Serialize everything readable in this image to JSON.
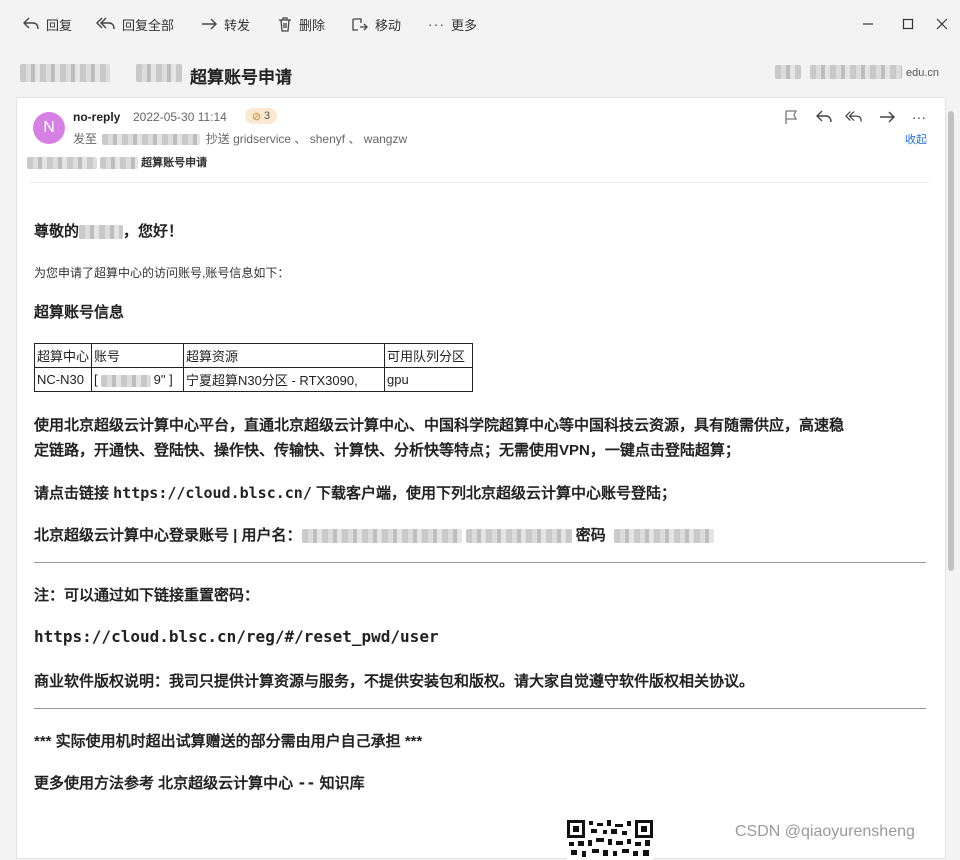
{
  "toolbar": {
    "reply": "回复",
    "reply_all": "回复全部",
    "forward": "转发",
    "delete": "删除",
    "move": "移动",
    "more": "更多"
  },
  "subject": "超算账号申请",
  "sender_domain": "edu.cn",
  "header": {
    "avatar_letter": "N",
    "from": "no-reply",
    "date": "2022-05-30 11:14",
    "attachments": "3",
    "to_prefix": "发至",
    "cc_prefix": "抄送",
    "cc_list": "gridservice 、 shenyf 、 wangzw",
    "collapse": "收起",
    "subject_small": "超算账号申请"
  },
  "body": {
    "greeting_a": "尊敬的",
    "greeting_b": "，您好！",
    "intro": "为您申请了超算中心的访问账号,账号信息如下：",
    "section_title": "超算账号信息",
    "table": {
      "headers": [
        "超算中心",
        "账号",
        "超算资源",
        "可用队列分区"
      ],
      "row": [
        "NC-N30",
        "[",
        "9\" ]",
        "宁夏超算N30分区 - RTX3090,",
        "gpu"
      ]
    },
    "para1_line1": "使用北京超级云计算中心平台，直通北京超级云计算中心、中国科学院超算中心等中国科技云资源，具有随需供应，高速稳",
    "para1_line2": "定链路，开通快、登陆快、操作快、传输快、计算快、分析快等特点；无需使用VPN，一键点击登陆超算；",
    "para2_a": "请点击链接 ",
    "para2_link": "https://cloud.blsc.cn/",
    "para2_b": " 下载客户端，使用下列北京超级云计算中心账号登陆；",
    "login_label": "北京超级云计算中心登录账号 | 用户名：",
    "password_label": "密码",
    "note": "注：可以通过如下链接重置密码：",
    "reset_link": "https://cloud.blsc.cn/reg/#/reset_pwd/user",
    "license": "商业软件版权说明：我司只提供计算资源与服务，不提供安装包和版权。请大家自觉遵守软件版权相关协议。",
    "notice": "*** 实际使用机时超出试算赠送的部分需由用户自己承担 ***",
    "more_a": "更多使用方法参考 北京超级云计算中心 ",
    "more_dash": "--",
    "more_b": " 知识库"
  },
  "watermark": "CSDN @qiaoyurensheng",
  "colors": {
    "accent": "#2b6fd6",
    "avatar": "#d780e3",
    "badge": "#fbe8d3"
  }
}
